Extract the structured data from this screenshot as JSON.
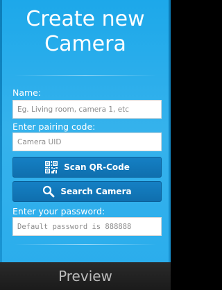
{
  "screen": {
    "title_line1": "Create new",
    "title_line2": "Camera"
  },
  "form": {
    "name_label": "Name:",
    "name_placeholder": "Eg. Living room, camera 1, etc",
    "pairing_label": "Enter pairing code:",
    "pairing_placeholder": "Camera UID",
    "scan_button_label": "Scan QR-Code",
    "scan_button_icon": "qr-code-icon",
    "search_button_label": "Search Camera",
    "search_button_icon": "magnifier-icon",
    "password_label": "Enter your password:",
    "password_placeholder": "Default password is 888888"
  },
  "footer": {
    "preview_label": "Preview"
  },
  "colors": {
    "background": "#29acec",
    "button": "#1278bb",
    "footer": "#222222"
  }
}
